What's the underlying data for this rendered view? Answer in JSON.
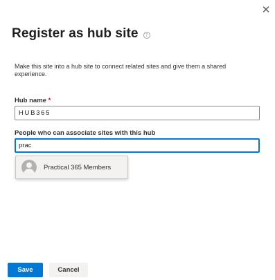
{
  "dialog": {
    "title": "Register as hub site",
    "help_icon_glyph": "?",
    "close_glyph": "✕",
    "description": "Make this site into a hub site to connect related sites and give them a shared experience."
  },
  "hub_name": {
    "label": "Hub name",
    "required_mark": "*",
    "value": "HUB365"
  },
  "people": {
    "label": "People who can associate sites with this hub",
    "value": "prac",
    "suggestion": "Practical 365 Members"
  },
  "buttons": {
    "save": "Save",
    "cancel": "Cancel"
  },
  "colors": {
    "primary": "#0078d4",
    "required": "#a4262c"
  }
}
